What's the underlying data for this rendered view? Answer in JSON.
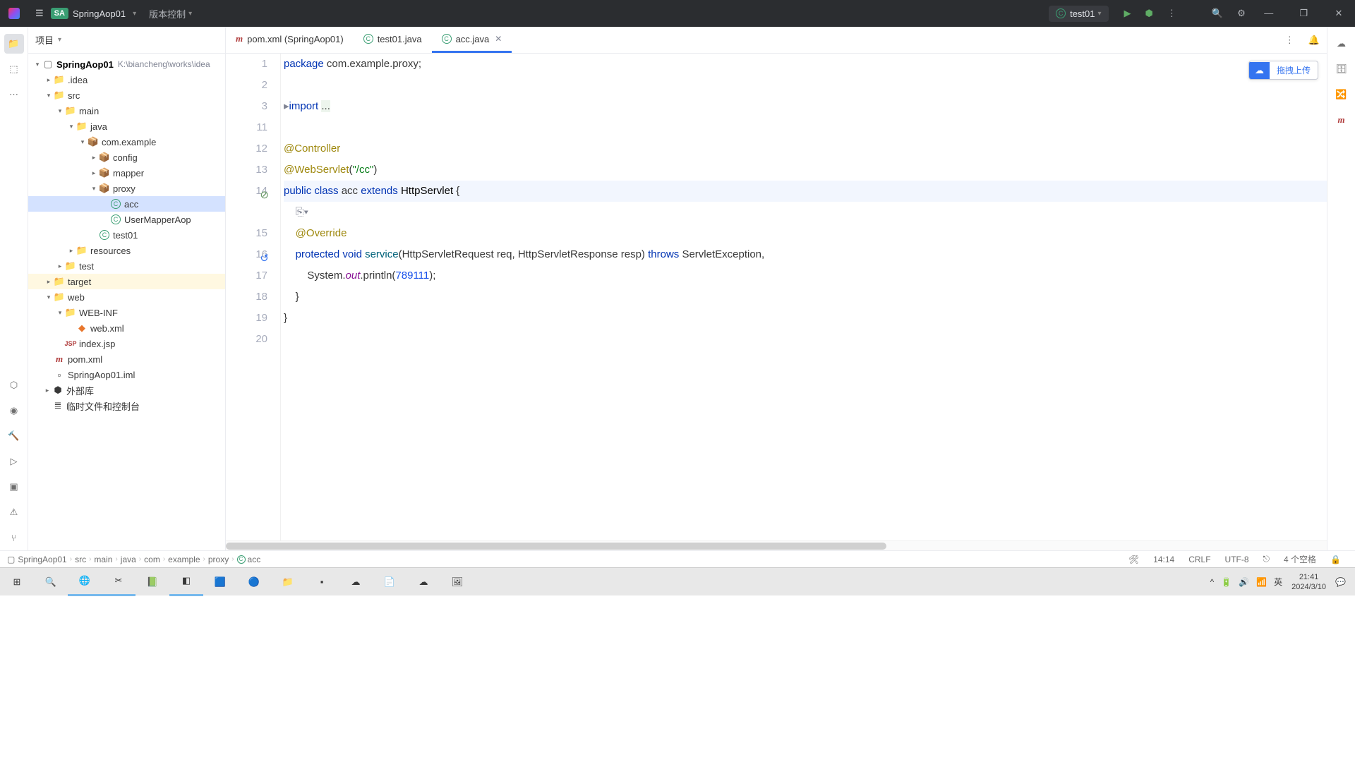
{
  "titlebar": {
    "project": "SpringAop01",
    "vcs": "版本控制",
    "runTarget": "test01"
  },
  "projectPanel": {
    "title": "项目"
  },
  "tree": {
    "root": {
      "name": "SpringAop01",
      "path": "K:\\biancheng\\works\\idea"
    },
    "idea": ".idea",
    "src": "src",
    "main": "main",
    "java": "java",
    "comExample": "com.example",
    "config": "config",
    "mapper": "mapper",
    "proxy": "proxy",
    "acc": "acc",
    "userMapperAop": "UserMapperAop",
    "test01": "test01",
    "resources": "resources",
    "test": "test",
    "target": "target",
    "web": "web",
    "webinf": "WEB-INF",
    "webxml": "web.xml",
    "indexjsp": "index.jsp",
    "pomxml": "pom.xml",
    "iml": "SpringAop01.iml",
    "extlibs": "外部库",
    "scratch": "临时文件和控制台"
  },
  "tabs": {
    "pom": "pom.xml (SpringAop01)",
    "test01": "test01.java",
    "acc": "acc.java"
  },
  "code": {
    "l1_kw": "package",
    "l1_rest": " com.example.proxy;",
    "l3_kw": "import",
    "l3_fold": "...",
    "l12": "@Controller",
    "l13_ann": "@WebServlet",
    "l13_paren": "(",
    "l13_str": "\"/cc\"",
    "l13_close": ")",
    "l14_public": "public ",
    "l14_class": "class ",
    "l14_name": "acc ",
    "l14_extends": "extends ",
    "l14_type": "HttpServlet",
    "l14_brace": " {",
    "l15": "@Override",
    "l16_prot": "protected ",
    "l16_void": "void ",
    "l16_fn": "service",
    "l16_sig1": "(HttpServletRequest req, HttpServletResponse resp) ",
    "l16_throws": "throws ",
    "l16_exc": "ServletException,",
    "l17_a": "System.",
    "l17_out": "out",
    "l17_b": ".println(",
    "l17_num": "789111",
    "l17_c": ");",
    "l18": "}",
    "l19": "}"
  },
  "gutter": {
    "l1": "1",
    "l2": "2",
    "l3": "3",
    "l11": "11",
    "l12": "12",
    "l13": "13",
    "l14": "14",
    "l15": "15",
    "l16": "16",
    "l17": "17",
    "l18": "18",
    "l19": "19",
    "l20": "20"
  },
  "uploadBtn": "拖拽上传",
  "breadcrumb": {
    "items": [
      "SpringAop01",
      "src",
      "main",
      "java",
      "com",
      "example",
      "proxy"
    ],
    "last": "acc"
  },
  "status": {
    "pos": "14:14",
    "lineEnd": "CRLF",
    "encoding": "UTF-8",
    "indent": "4 个空格"
  },
  "tray": {
    "ime": "英",
    "time": "21:41",
    "date": "2024/3/10"
  }
}
